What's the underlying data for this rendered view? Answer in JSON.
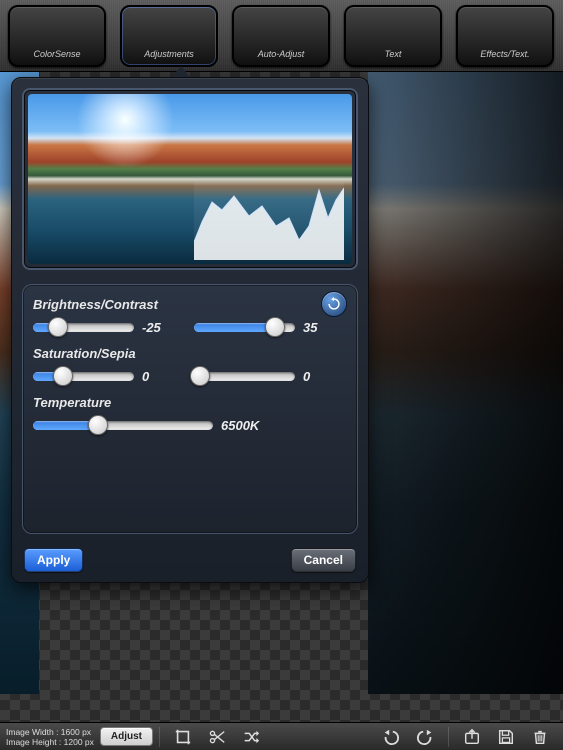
{
  "toolbar": {
    "items": [
      {
        "label": "ColorSense",
        "icon": "colorsense-icon"
      },
      {
        "label": "Adjustments",
        "icon": "adjustments-icon"
      },
      {
        "label": "Auto-Adjust",
        "icon": "auto-adjust-icon"
      },
      {
        "label": "Text",
        "icon": "text-icon"
      },
      {
        "label": "Effects/Text.",
        "icon": "fx-icon"
      }
    ],
    "active_index": 1
  },
  "adjust_panel": {
    "sections": {
      "brightness_contrast": {
        "label": "Brightness/Contrast",
        "brightness": {
          "value": -25,
          "display": "-25",
          "min": -100,
          "max": 100,
          "fill_pct": 25,
          "knob_pct": 25
        },
        "contrast": {
          "value": 35,
          "display": "35",
          "min": -100,
          "max": 100,
          "fill_pct": 80,
          "knob_pct": 80
        }
      },
      "saturation_sepia": {
        "label": "Saturation/Sepia",
        "saturation": {
          "value": 0,
          "display": "0",
          "min": -100,
          "max": 100,
          "fill_pct": 30,
          "knob_pct": 30
        },
        "sepia": {
          "value": 0,
          "display": "0",
          "min": 0,
          "max": 100,
          "fill_pct": 6,
          "knob_pct": 6
        }
      },
      "temperature": {
        "label": "Temperature",
        "temp": {
          "value": 6500,
          "display": "6500K",
          "min": 2000,
          "max": 12000,
          "fill_pct": 36,
          "knob_pct": 36
        }
      }
    },
    "buttons": {
      "apply": "Apply",
      "cancel": "Cancel"
    }
  },
  "statusbar": {
    "image_width_label": "Image Width : 1600 px",
    "image_height_label": "Image Height : 1200 px",
    "adjust_button": "Adjust"
  },
  "colors": {
    "accent": "#3b7fe0",
    "panel": "#222a35"
  }
}
